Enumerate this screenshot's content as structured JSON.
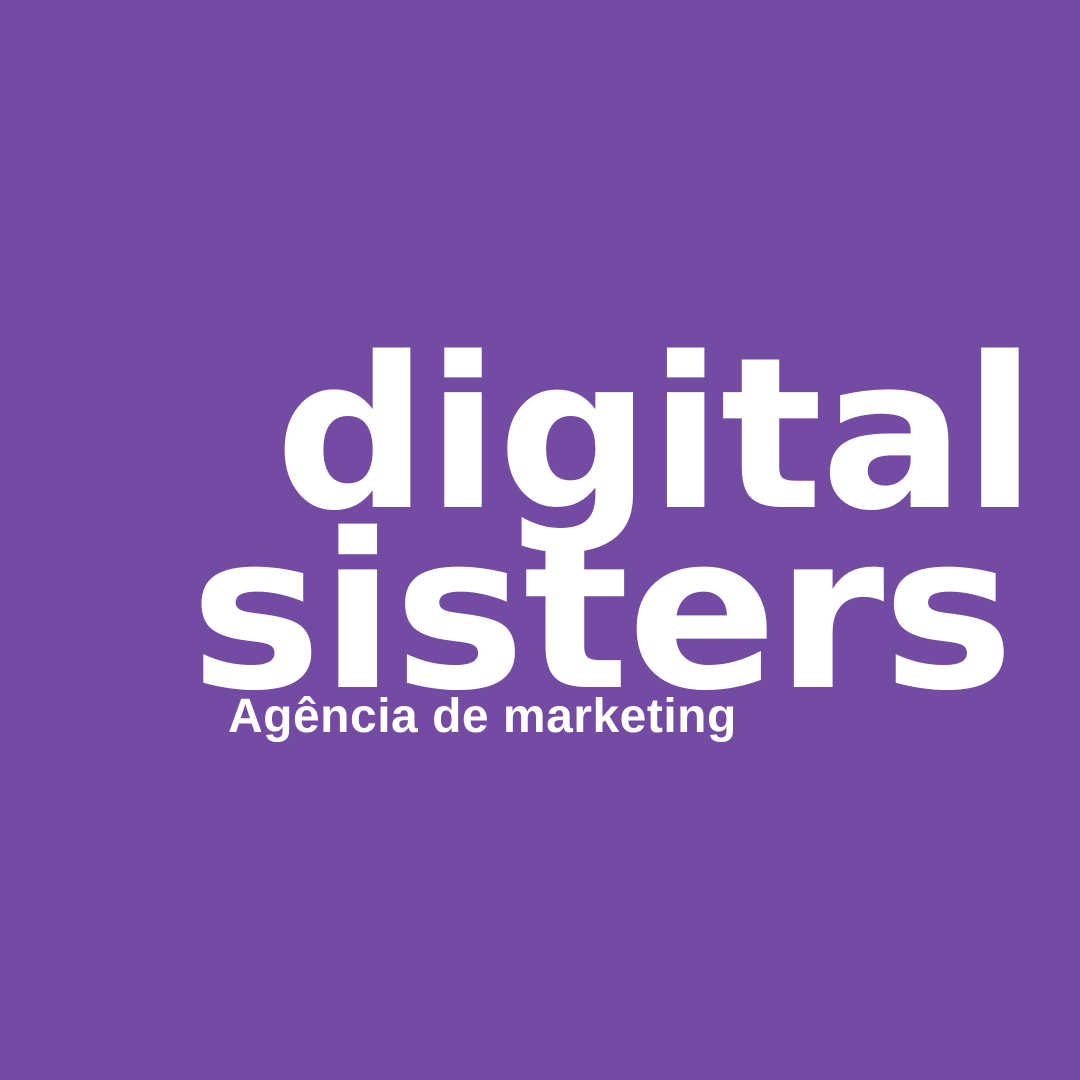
{
  "background_color": "#744ba2",
  "text_color": "#ffffff",
  "logo": {
    "line1": "digital",
    "line2": "sisters",
    "tagline": "Agência de marketing"
  }
}
